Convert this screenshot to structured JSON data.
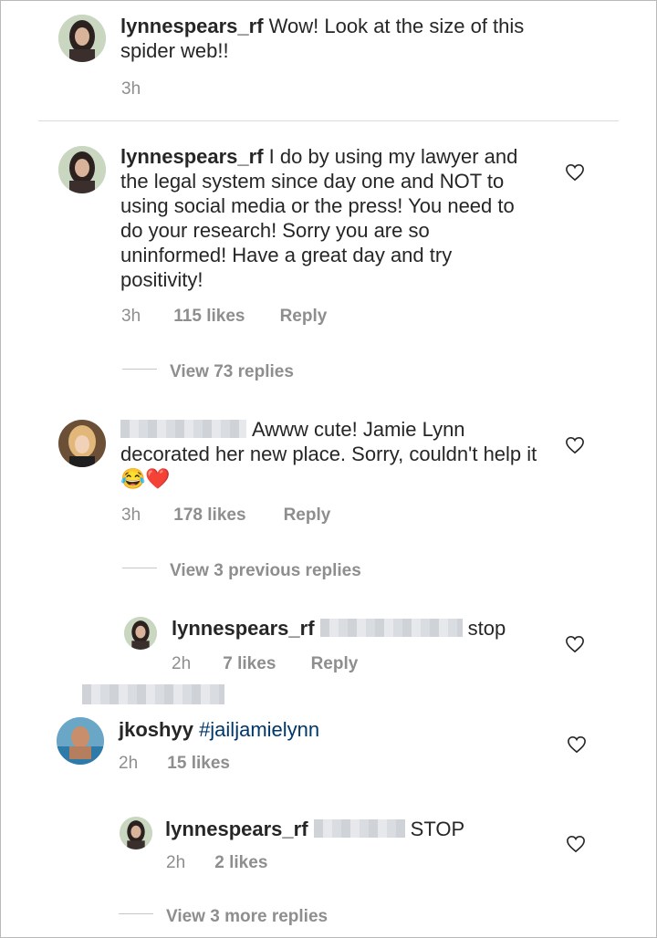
{
  "caption": {
    "username": "lynnespears_rf",
    "text": "Wow! Look at the size of this spider web!!",
    "time": "3h"
  },
  "comments": [
    {
      "username": "lynnespears_rf",
      "text": "I do by using my lawyer and the legal system since day one  and NOT to using social media or the press! You need to do your research! Sorry you are so uninformed! Have a great day and try positivity!",
      "time": "3h",
      "likes": "115 likes",
      "reply": "Reply",
      "view_replies": "View 73 replies"
    },
    {
      "username": "",
      "text": "Awww cute! Jamie Lynn decorated her new place. Sorry, couldn't help it",
      "emoji": "😂❤️",
      "time": "3h",
      "likes": "178 likes",
      "reply": "Reply",
      "view_replies": "View 3 previous replies"
    },
    {
      "username": "lynnespears_rf",
      "text": "stop",
      "time": "2h",
      "likes": "7 likes",
      "reply": "Reply"
    },
    {
      "username": "jkoshyy",
      "text": "#jailjamielynn",
      "time": "2h",
      "likes": "15 likes"
    },
    {
      "username": "lynnespears_rf",
      "text": "STOP",
      "time": "2h",
      "likes": "2 likes",
      "view_replies": "View 3 more replies"
    }
  ],
  "icons": {
    "like": "heart-outline-icon"
  },
  "colors": {
    "text": "#262626",
    "meta": "#8e8e8e",
    "hashtag": "#00376b",
    "divider": "#dbdbdb"
  }
}
